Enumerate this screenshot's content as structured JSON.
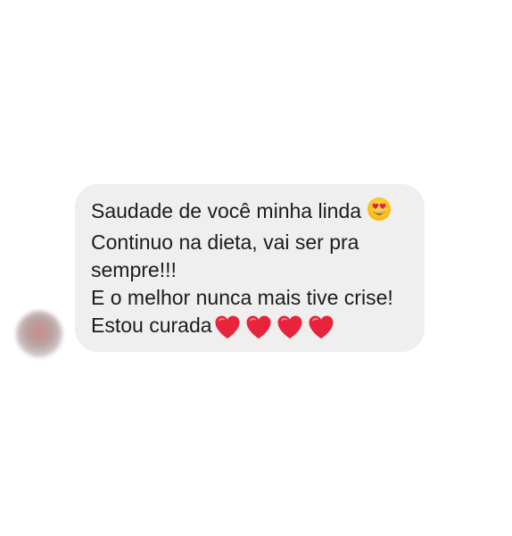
{
  "message": {
    "lines": [
      "Saudade de você minha linda",
      "Continuo na dieta, vai ser pra",
      "sempre!!!",
      "E o melhor nunca mais tive crise!",
      "Estou curada"
    ],
    "first_line_emoji": "heart-eyes-emoji",
    "last_line_emoji": "red-heart-emoji",
    "last_line_emoji_count": 4
  },
  "colors": {
    "bubble_background": "#efefef",
    "text": "#1c1c1c",
    "heart": "#e8243d"
  }
}
